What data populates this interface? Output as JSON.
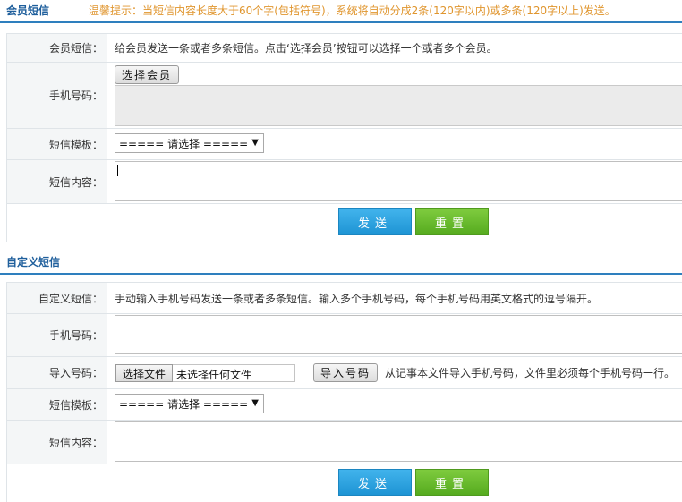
{
  "member_section": {
    "title": "会员短信",
    "tip": "温馨提示：当短信内容长度大于60个字(包括符号)，系统将自动分成2条(120字以内)或多条(120字以上)发送。",
    "member_sms_label": "会员短信：",
    "member_sms_desc": "给会员发送一条或者多条短信。点击‘选择会员’按钮可以选择一个或者多个会员。",
    "phone_label": "手机号码：",
    "select_member_button": "选择会员",
    "template_label": "短信模板：",
    "template_selected": "===== 请选择 =====",
    "content_label": "短信内容：",
    "send_button": "发送",
    "reset_button": "重置"
  },
  "custom_section": {
    "title": "自定义短信",
    "custom_sms_label": "自定义短信：",
    "custom_sms_desc": "手动输入手机号码发送一条或者多条短信。输入多个手机号码，每个手机号码用英文格式的逗号隔开。",
    "phone_label": "手机号码：",
    "import_label": "导入号码：",
    "choose_file_button": "选择文件",
    "no_file_text": "未选择任何文件",
    "import_button": "导入号码",
    "import_desc": "从记事本文件导入手机号码，文件里必须每个手机号码一行。",
    "template_label": "短信模板：",
    "template_selected": "===== 请选择 =====",
    "content_label": "短信内容：",
    "send_button": "发送",
    "reset_button": "重置"
  },
  "icons": {
    "dropdown": "chevron-down-icon"
  }
}
